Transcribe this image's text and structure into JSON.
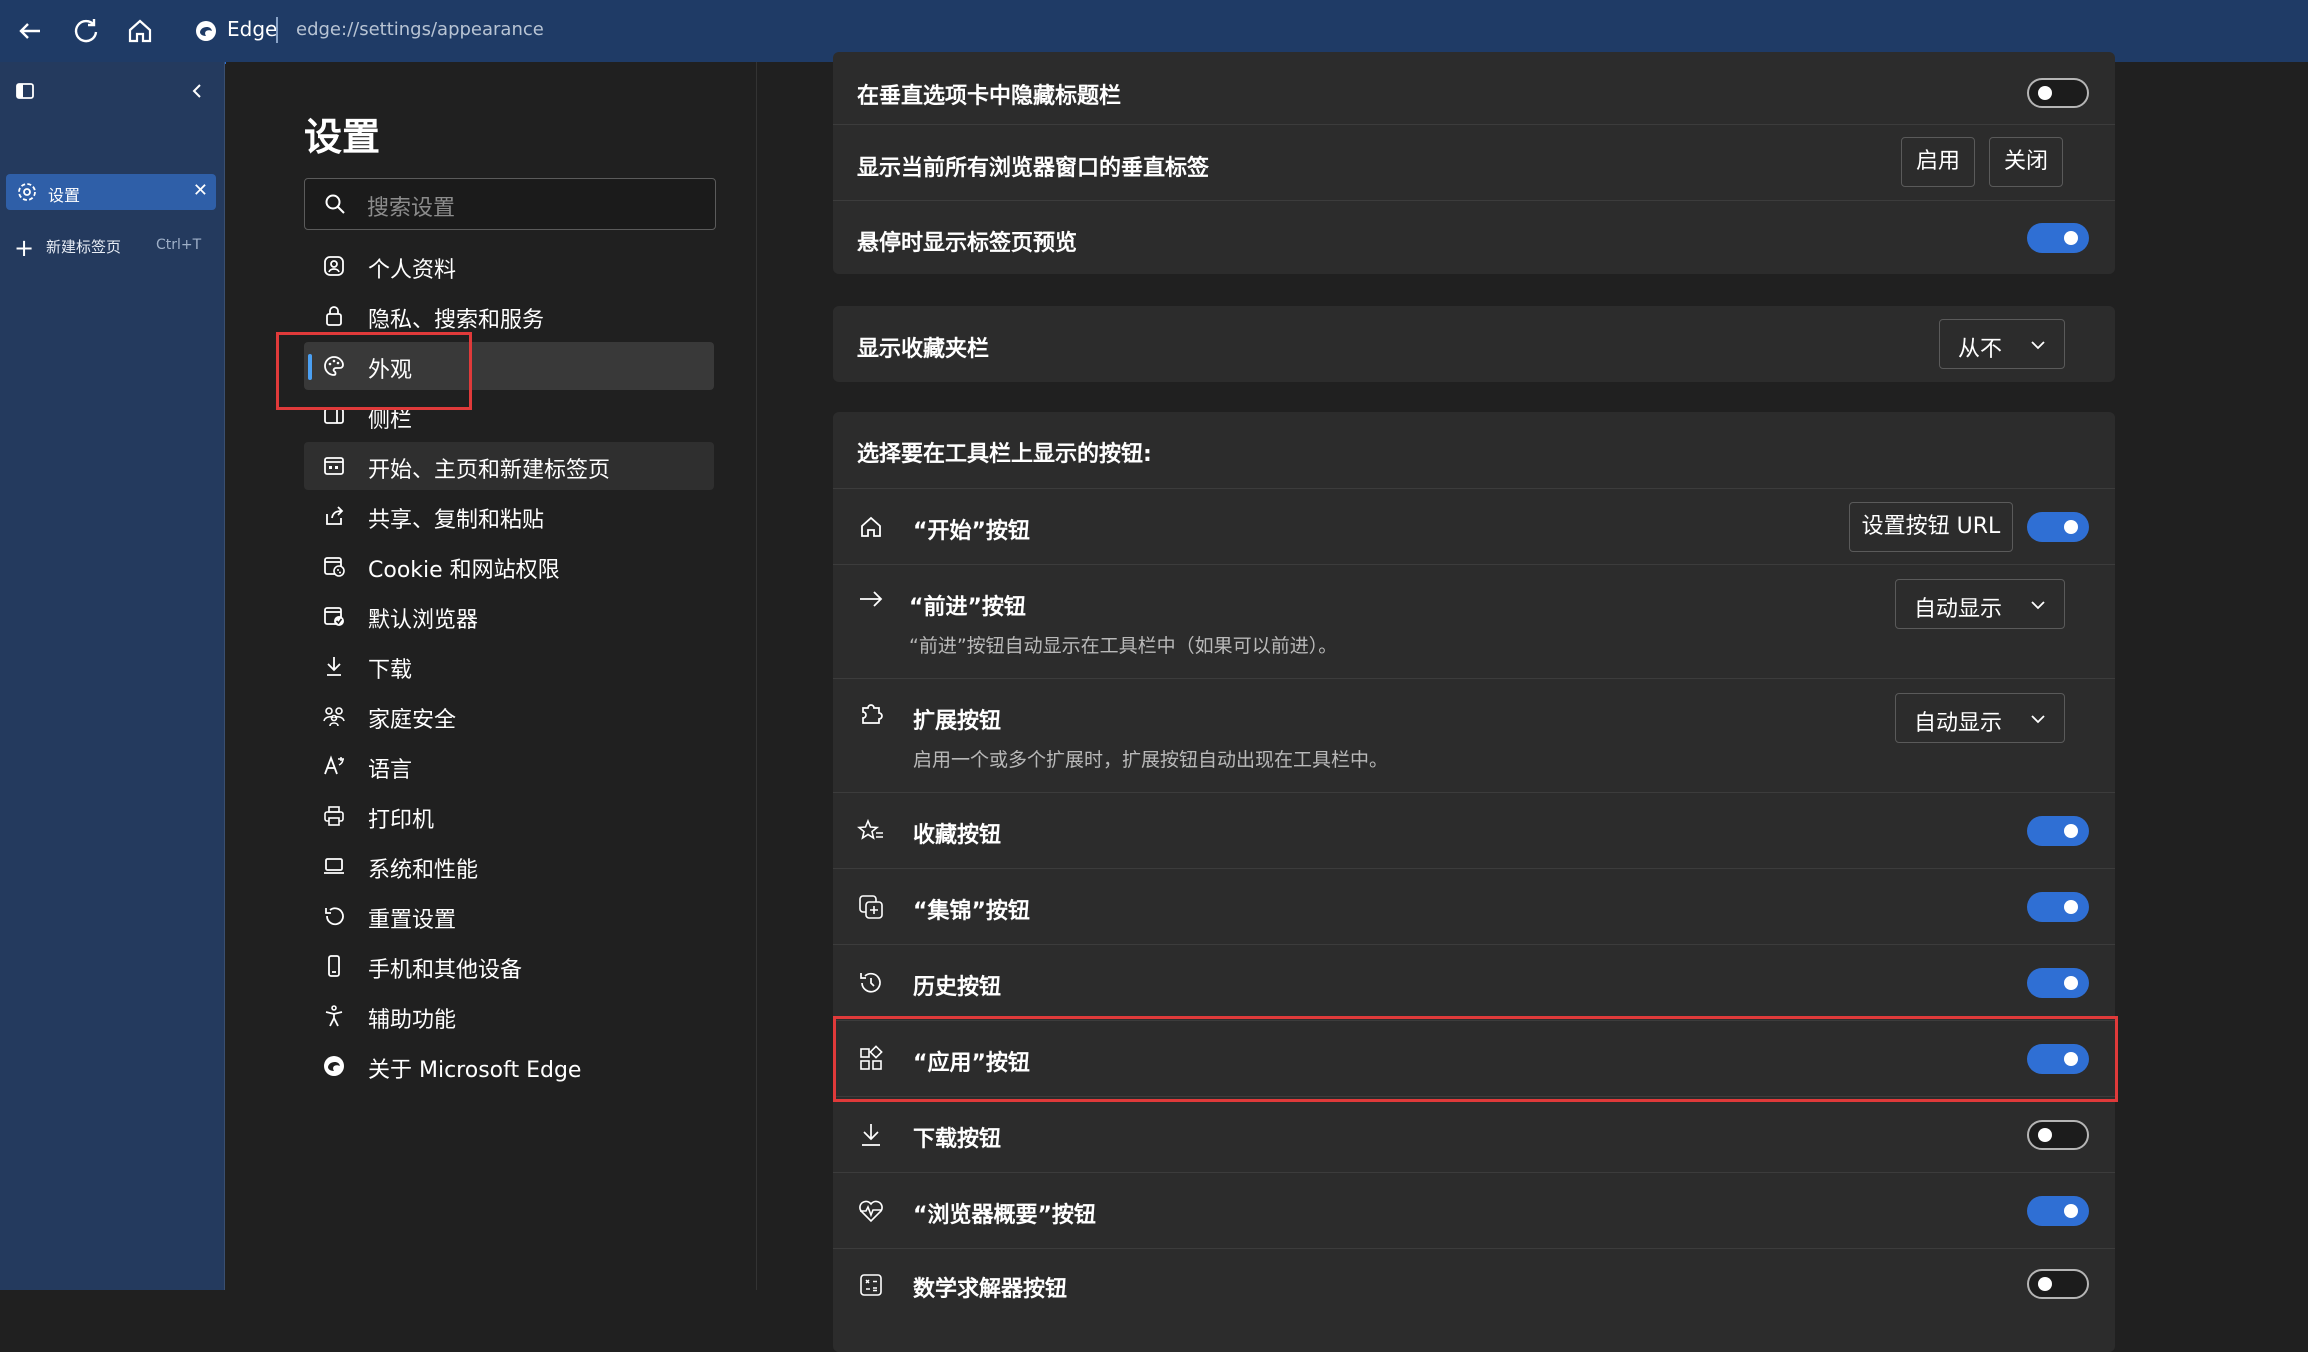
{
  "browser": {
    "name": "Edge",
    "url": "edge://settings/appearance"
  },
  "vertical_tabs": {
    "settings_tab_label": "设置",
    "new_tab_label": "新建标签页",
    "new_tab_shortcut": "Ctrl+T"
  },
  "nav": {
    "title": "设置",
    "search_placeholder": "搜索设置",
    "items": [
      {
        "label": "个人资料",
        "icon": "profile-icon"
      },
      {
        "label": "隐私、搜索和服务",
        "icon": "lock-icon"
      },
      {
        "label": "外观",
        "icon": "palette-icon",
        "active": true
      },
      {
        "label": "侧栏",
        "icon": "sidebar-icon"
      },
      {
        "label": "开始、主页和新建标签页",
        "icon": "home-grid-icon"
      },
      {
        "label": "共享、复制和粘贴",
        "icon": "share-icon"
      },
      {
        "label": "Cookie 和网站权限",
        "icon": "cookie-icon"
      },
      {
        "label": "默认浏览器",
        "icon": "browser-icon"
      },
      {
        "label": "下载",
        "icon": "download-icon"
      },
      {
        "label": "家庭安全",
        "icon": "family-icon"
      },
      {
        "label": "语言",
        "icon": "language-icon"
      },
      {
        "label": "打印机",
        "icon": "printer-icon"
      },
      {
        "label": "系统和性能",
        "icon": "laptop-icon"
      },
      {
        "label": "重置设置",
        "icon": "reset-icon"
      },
      {
        "label": "手机和其他设备",
        "icon": "phone-icon"
      },
      {
        "label": "辅助功能",
        "icon": "accessibility-icon"
      },
      {
        "label": "关于 Microsoft Edge",
        "icon": "edge-logo-icon"
      }
    ]
  },
  "card1": {
    "hide_titlebar": {
      "label": "在垂直选项卡中隐藏标题栏",
      "toggle": "off"
    },
    "vertical_tabs_all": {
      "label": "显示当前所有浏览器窗口的垂直标签",
      "enable_label": "启用",
      "disable_label": "关闭"
    },
    "hover_preview": {
      "label": "悬停时显示标签页预览",
      "toggle": "on"
    }
  },
  "card2": {
    "favorites_bar": {
      "label": "显示收藏夹栏",
      "value": "从不"
    }
  },
  "card3": {
    "header": "选择要在工具栏上显示的按钮:",
    "home": {
      "label": "“开始”按钮",
      "url_button": "设置按钮 URL",
      "toggle": "on"
    },
    "forward": {
      "label": "“前进”按钮",
      "desc": "“前进”按钮自动显示在工具栏中（如果可以前进）。",
      "value": "自动显示"
    },
    "extensions": {
      "label": "扩展按钮",
      "desc": "启用一个或多个扩展时，扩展按钮自动出现在工具栏中。",
      "value": "自动显示"
    },
    "favorites": {
      "label": "收藏按钮",
      "toggle": "on"
    },
    "collections": {
      "label": "“集锦”按钮",
      "toggle": "on"
    },
    "history": {
      "label": "历史按钮",
      "toggle": "on"
    },
    "apps": {
      "label": "“应用”按钮",
      "toggle": "on"
    },
    "downloads": {
      "label": "下载按钮",
      "toggle": "off"
    },
    "essentials": {
      "label": "“浏览器概要”按钮",
      "toggle": "on"
    },
    "math": {
      "label": "数学求解器按钮",
      "toggle": "off"
    }
  },
  "colors": {
    "accent": "#2f6fd4",
    "highlight": "#e03a3a"
  }
}
